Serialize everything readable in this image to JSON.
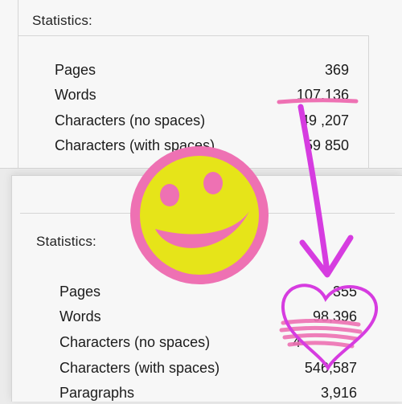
{
  "top_panel": {
    "heading": "Statistics:",
    "rows": [
      {
        "label": "Pages",
        "value": "369"
      },
      {
        "label": "Words",
        "value": "107,136"
      },
      {
        "label": "Characters (no spaces)",
        "value": "49 ,207"
      },
      {
        "label": "Characters (with spaces)",
        "value": "59 850"
      }
    ]
  },
  "bottom_panel": {
    "heading": "Statistics:",
    "rows": [
      {
        "label": "Pages",
        "value": "355"
      },
      {
        "label": "Words",
        "value": "98,396"
      },
      {
        "label": "Characters (no spaces)",
        "value": "4"
      },
      {
        "label": "Characters (with spaces)",
        "value": "546,587"
      },
      {
        "label": "Paragraphs",
        "value": "3,916"
      }
    ]
  },
  "colors": {
    "magenta": "#d63ce0",
    "pink": "#ee71b3",
    "yellow": "#e6e419",
    "panel_bg": "#f7f7f7"
  },
  "icons": [
    "smiley-icon",
    "arrow-icon",
    "heart-icon"
  ]
}
